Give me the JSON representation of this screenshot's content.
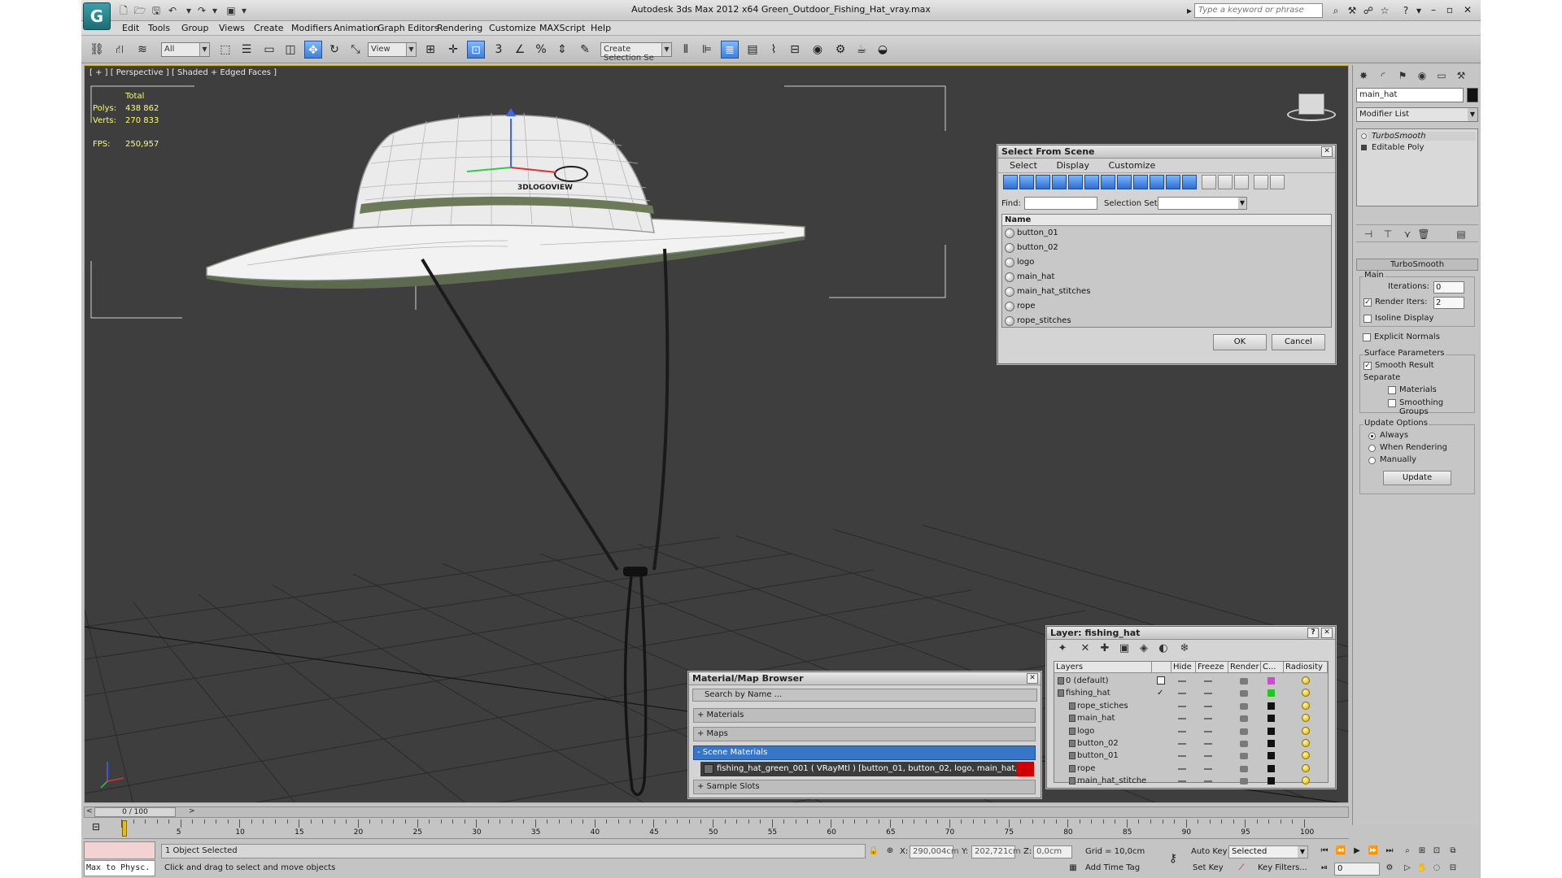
{
  "window": {
    "title": "Autodesk 3ds Max  2012 x64    Green_Outdoor_Fishing_Hat_vray.max",
    "search_placeholder": "Type a keyword or phrase"
  },
  "menu": [
    "Edit",
    "Tools",
    "Group",
    "Views",
    "Create",
    "Modifiers",
    "Animation",
    "Graph Editors",
    "Rendering",
    "Customize",
    "MAXScript",
    "Help"
  ],
  "toolbar": {
    "filter": "All",
    "ref_coord": "View",
    "selection_set": "Create Selection Se"
  },
  "viewport": {
    "label": "[ + ] [ Perspective ] [ Shaded + Edged Faces ]",
    "stats_header": "Total",
    "polys_label": "Polys:",
    "polys_value": "438 862",
    "verts_label": "Verts:",
    "verts_value": "270 833",
    "fps_label": "FPS:",
    "fps_value": "250,957",
    "logo_text": "3DLOGOVIEW"
  },
  "select_from_scene": {
    "title": "Select From Scene",
    "menu": [
      "Select",
      "Display",
      "Customize"
    ],
    "find_label": "Find:",
    "selection_set_label": "Selection Set:",
    "column_name": "Name",
    "objects": [
      "button_01",
      "button_02",
      "logo",
      "main_hat",
      "main_hat_stitches",
      "rope",
      "rope_stitches"
    ],
    "ok": "OK",
    "cancel": "Cancel"
  },
  "material_browser": {
    "title": "Material/Map Browser",
    "search": "Search by Name ...",
    "groups": [
      "+ Materials",
      "+ Maps",
      "- Scene Materials"
    ],
    "scene_material": "fishing_hat_green_001  ( VRayMtl )  [button_01, button_02, logo, main_hat, mai...",
    "sample_slots": "+ Sample Slots"
  },
  "layer_dialog": {
    "title": "Layer: fishing_hat",
    "columns": [
      "Layers",
      "Hide",
      "Freeze",
      "Render",
      "C...",
      "Radiosity"
    ],
    "rows": [
      {
        "name": "0 (default)",
        "indent": 0,
        "color": "#d04ad0"
      },
      {
        "name": "fishing_hat",
        "indent": 0,
        "color": "#22c522"
      },
      {
        "name": "rope_stiches",
        "indent": 1,
        "color": "#111111"
      },
      {
        "name": "main_hat",
        "indent": 1,
        "color": "#111111"
      },
      {
        "name": "logo",
        "indent": 1,
        "color": "#111111"
      },
      {
        "name": "button_02",
        "indent": 1,
        "color": "#111111"
      },
      {
        "name": "button_01",
        "indent": 1,
        "color": "#111111"
      },
      {
        "name": "rope",
        "indent": 1,
        "color": "#111111"
      },
      {
        "name": "main_hat_stitche",
        "indent": 1,
        "color": "#111111"
      }
    ]
  },
  "command_panel": {
    "object_name": "main_hat",
    "modifier_list": "Modifier List",
    "stack": [
      "TurboSmooth",
      "Editable Poly"
    ],
    "rollout": "TurboSmooth",
    "main_group": "Main",
    "iterations_label": "Iterations:",
    "iterations": "0",
    "render_iters_label": "Render Iters:",
    "render_iters": "2",
    "isoline": "Isoline Display",
    "explicit_normals": "Explicit Normals",
    "surface_group": "Surface Parameters",
    "smooth_result": "Smooth Result",
    "separate_label": "Separate",
    "materials": "Materials",
    "smoothing_groups": "Smoothing Groups",
    "update_group": "Update Options",
    "always": "Always",
    "when_rendering": "When Rendering",
    "manually": "Manually",
    "update_btn": "Update"
  },
  "timeline": {
    "slider": "0 / 100",
    "ticks": [
      "5",
      "10",
      "15",
      "20",
      "25",
      "30",
      "35",
      "40",
      "45",
      "50",
      "55",
      "60",
      "65",
      "70",
      "75",
      "80",
      "85",
      "90",
      "95",
      "100"
    ]
  },
  "status": {
    "maxscript": "Max to Physc.",
    "selection": "1 Object Selected",
    "prompt": "Click and drag to select and move objects",
    "x_label": "X:",
    "x_value": "290,004cm",
    "y_label": "Y:",
    "y_value": "202,721cm",
    "z_label": "Z:",
    "z_value": "0,0cm",
    "grid": "Grid = 10,0cm",
    "auto_key": "Auto Key",
    "set_key": "Set Key",
    "key_mode": "Selected",
    "key_filters": "Key Filters...",
    "add_time_tag": "Add Time Tag",
    "frame": "0"
  }
}
